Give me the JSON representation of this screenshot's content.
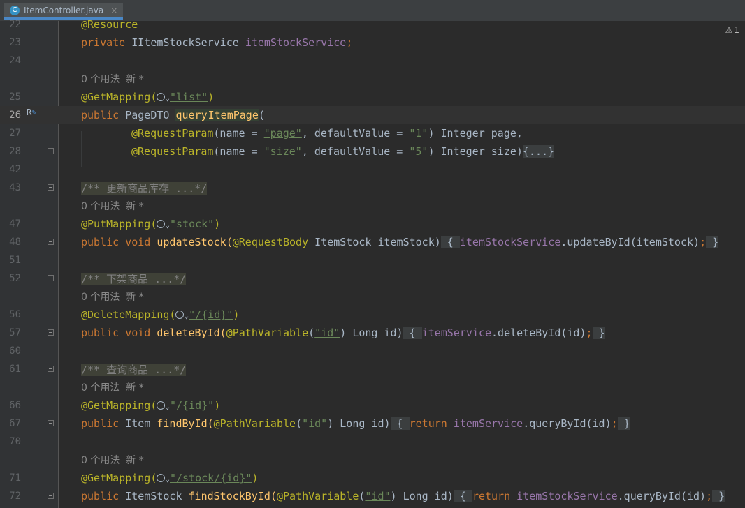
{
  "tab": {
    "label": "ItemController.java",
    "icon": "class-icon",
    "icon_letter": "C",
    "close": "×"
  },
  "inspection": {
    "icon": "warning-icon",
    "count": "1"
  },
  "hint": {
    "usages": "0 个用法",
    "author": "新 *"
  },
  "lines": {
    "l22": {
      "num": "22",
      "text": "@Resource"
    },
    "l23": {
      "num": "23",
      "kw": "private ",
      "type": "IItemStockService ",
      "field": "itemStockService",
      "end": ";"
    },
    "l24": {
      "num": "24"
    },
    "l25": {
      "num": "25",
      "ann": "@GetMapping(",
      "str": "\"list\"",
      "end": ")"
    },
    "l26": {
      "num": "26",
      "marker": "R",
      "kw": "public ",
      "type": "PageDTO ",
      "name_a": "query",
      "name_b": "ItemPage",
      "end": "("
    },
    "l27": {
      "num": "27",
      "ann": "@RequestParam",
      "p1": "(name = ",
      "s1": "\"page\"",
      "p2": ", defaultValue = ",
      "s2": "\"1\"",
      "p3": ") Integer page,"
    },
    "l28": {
      "num": "28",
      "ann": "@RequestParam",
      "p1": "(name = ",
      "s1": "\"size\"",
      "p2": ", defaultValue = ",
      "s2": "\"5\"",
      "p3": ") Integer size)",
      "fold": "{...}"
    },
    "l42": {
      "num": "42"
    },
    "l43": {
      "num": "43",
      "comment": "/** 更新商品库存 ...*/"
    },
    "l47": {
      "num": "47",
      "ann": "@PutMapping(",
      "str": "\"stock\"",
      "end": ")"
    },
    "l48": {
      "num": "48",
      "kw": "public void ",
      "name": "updateStock(",
      "ann": "@RequestBody",
      "rest": " ItemStock itemStock)",
      "b1": " { ",
      "field": "itemStockService",
      "call": ".updateById(itemStock)",
      "semi": ";",
      "b2": " }"
    },
    "l51": {
      "num": "51"
    },
    "l52": {
      "num": "52",
      "comment": "/** 下架商品 ...*/"
    },
    "l56": {
      "num": "56",
      "ann": "@DeleteMapping(",
      "str": "\"/{id}\"",
      "end": ")"
    },
    "l57": {
      "num": "57",
      "kw": "public void ",
      "name": "deleteById(",
      "ann": "@PathVariable",
      "p1": "(",
      "str": "\"id\"",
      "rest": ") Long id)",
      "b1": " { ",
      "field": "itemService",
      "call": ".deleteById(id)",
      "semi": ";",
      "b2": " }"
    },
    "l60": {
      "num": "60"
    },
    "l61": {
      "num": "61",
      "comment": "/** 查询商品 ...*/"
    },
    "l66": {
      "num": "66",
      "ann": "@GetMapping(",
      "str": "\"/{id}\"",
      "end": ")"
    },
    "l67": {
      "num": "67",
      "kw": "public ",
      "type": "Item ",
      "name": "findById(",
      "ann": "@PathVariable",
      "p1": "(",
      "str": "\"id\"",
      "rest": ") Long id)",
      "b1": " { ",
      "ret": "return ",
      "field": "itemService",
      "call": ".queryById(id)",
      "semi": ";",
      "b2": " }"
    },
    "l70": {
      "num": "70"
    },
    "l71": {
      "num": "71",
      "ann": "@GetMapping(",
      "str": "\"/stock/{id}\"",
      "end": ")"
    },
    "l72": {
      "num": "72",
      "kw": "public ",
      "type": "ItemStock ",
      "name": "findStockById(",
      "ann": "@PathVariable",
      "p1": "(",
      "str": "\"id\"",
      "rest": ") Long id)",
      "b1": " { ",
      "ret": "return ",
      "field": "itemStockService",
      "call": ".queryById(id)",
      "semi": ";",
      "b2": " }"
    }
  }
}
